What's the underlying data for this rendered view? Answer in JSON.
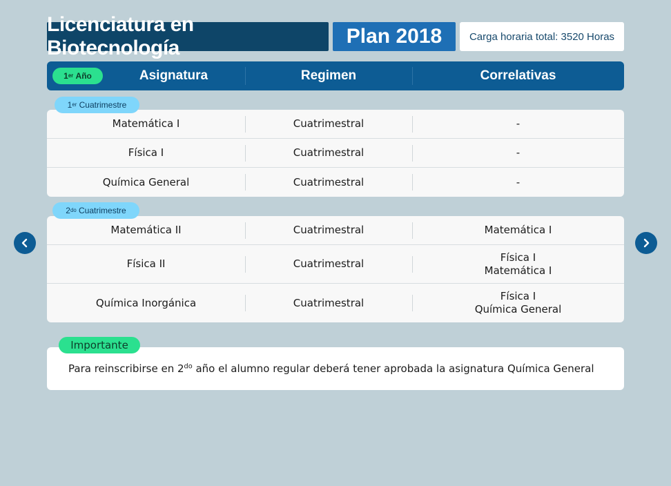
{
  "header": {
    "title": "Licenciatura en Biotecnología",
    "plan": "Plan 2018",
    "hours": "Carga horaria total: 3520 Horas"
  },
  "columns": {
    "year_number": "1",
    "year_sup": "er",
    "year_label": "Año",
    "subject": "Asignatura",
    "regime": "Regimen",
    "correlatives": "Correlativas"
  },
  "semesters": [
    {
      "pill_number": "1",
      "pill_sup": "er",
      "pill_label": "Cuatrimestre",
      "rows": [
        {
          "subject": "Matemática I",
          "regime": "Cuatrimestral",
          "correlatives": [
            "-"
          ]
        },
        {
          "subject": "Física I",
          "regime": "Cuatrimestral",
          "correlatives": [
            "-"
          ]
        },
        {
          "subject": "Química General",
          "regime": "Cuatrimestral",
          "correlatives": [
            "-"
          ]
        }
      ]
    },
    {
      "pill_number": "2",
      "pill_sup": "do",
      "pill_label": "Cuatrimestre",
      "rows": [
        {
          "subject": "Matemática II",
          "regime": "Cuatrimestral",
          "correlatives": [
            "Matemática I"
          ]
        },
        {
          "subject": "Física II",
          "regime": "Cuatrimestral",
          "correlatives": [
            "Física I",
            "Matemática I"
          ]
        },
        {
          "subject": "Química Inorgánica",
          "regime": "Cuatrimestral",
          "correlatives": [
            "Física I",
            "Química General"
          ]
        }
      ]
    }
  ],
  "important": {
    "label": "Importante",
    "text_before": "Para reinscribirse en 2",
    "text_sup": "do",
    "text_after": " año el alumno regular deberá tener aprobada la asignatura Química General"
  },
  "nav": {
    "prev_icon": "chevron-left-icon",
    "next_icon": "chevron-right-icon"
  },
  "colors": {
    "background": "#bfd0d7",
    "title_bg": "#0e4568",
    "plan_bg": "#1e6fb5",
    "header_bar": "#0d5c94",
    "green_pill": "#2be08f",
    "blue_pill": "#7fd6fb"
  }
}
